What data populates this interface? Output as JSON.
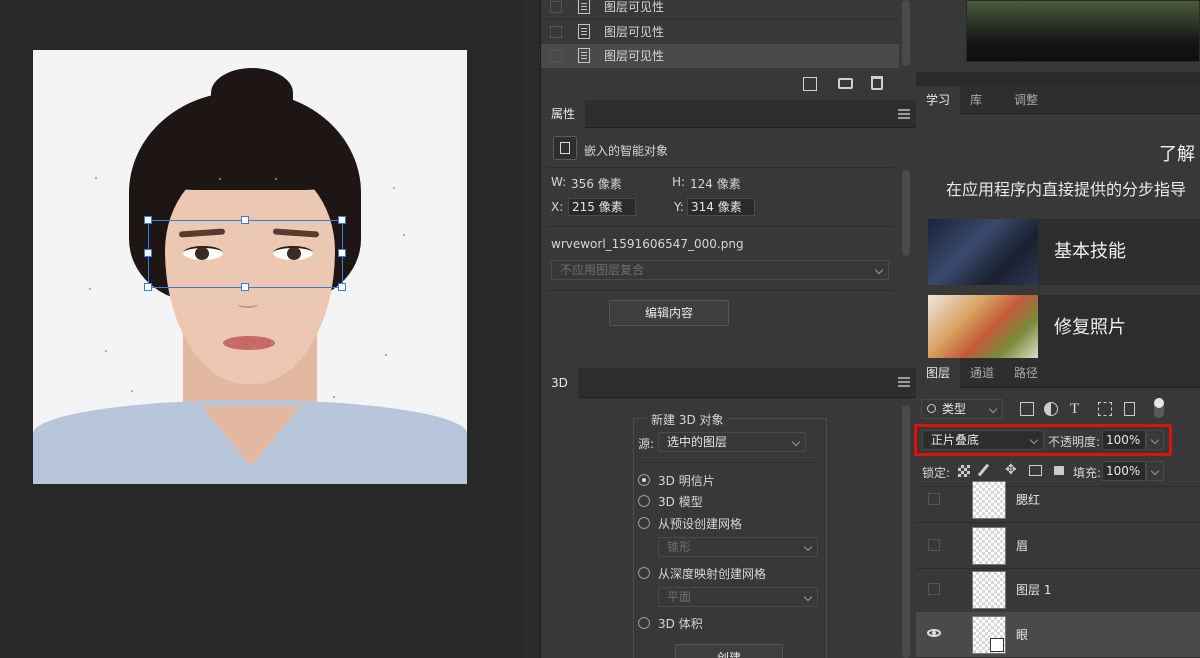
{
  "visibility_panel": {
    "rows": [
      {
        "label": "图层可见性"
      },
      {
        "label": "图层可见性"
      },
      {
        "label": "图层可见性"
      }
    ]
  },
  "properties": {
    "tab": "属性",
    "type_label": "嵌入的智能对象",
    "w_label": "W:",
    "w_value": "356 像素",
    "h_label": "H:",
    "h_value": "124 像素",
    "x_label": "X:",
    "x_value": "215 像素",
    "y_label": "Y:",
    "y_value": "314 像素",
    "filename": "wrveworl_1591606547_000.png",
    "comp_placeholder": "不应用图层复合",
    "edit_button": "编辑内容"
  },
  "panel3d": {
    "tab": "3D",
    "group_title": "新建 3D 对象",
    "source_label": "源:",
    "source_value": "选中的图层",
    "options": [
      {
        "label": "3D 明信片",
        "selected": true
      },
      {
        "label": "3D 模型",
        "selected": false
      },
      {
        "label": "从预设创建网格",
        "selected": false
      },
      {
        "label": "从深度映射创建网格",
        "selected": false
      },
      {
        "label": "3D 体积",
        "selected": false
      }
    ],
    "preset_dropdown": "锥形",
    "depth_dropdown": "平面",
    "create_button": "创建"
  },
  "learn": {
    "tabs": [
      "学习",
      "库",
      "调整"
    ],
    "heading": "了解",
    "subheading": "在应用程序内直接提供的分步指导",
    "cards": [
      {
        "label": "基本技能"
      },
      {
        "label": "修复照片"
      }
    ]
  },
  "layers": {
    "tabs": [
      "图层",
      "通道",
      "路径"
    ],
    "filter_label": "类型",
    "blend_mode": "正片叠底",
    "opacity_label": "不透明度:",
    "opacity_value": "100%",
    "lock_label": "锁定:",
    "fill_label": "填充:",
    "fill_value": "100%",
    "items": [
      {
        "name": "腮红",
        "visible": false
      },
      {
        "name": "眉",
        "visible": false
      },
      {
        "name": "图层 1",
        "visible": false
      },
      {
        "name": "眼",
        "visible": true
      }
    ]
  },
  "colors": {
    "highlight_box": "#e01010",
    "selection": "#3a7de0"
  }
}
